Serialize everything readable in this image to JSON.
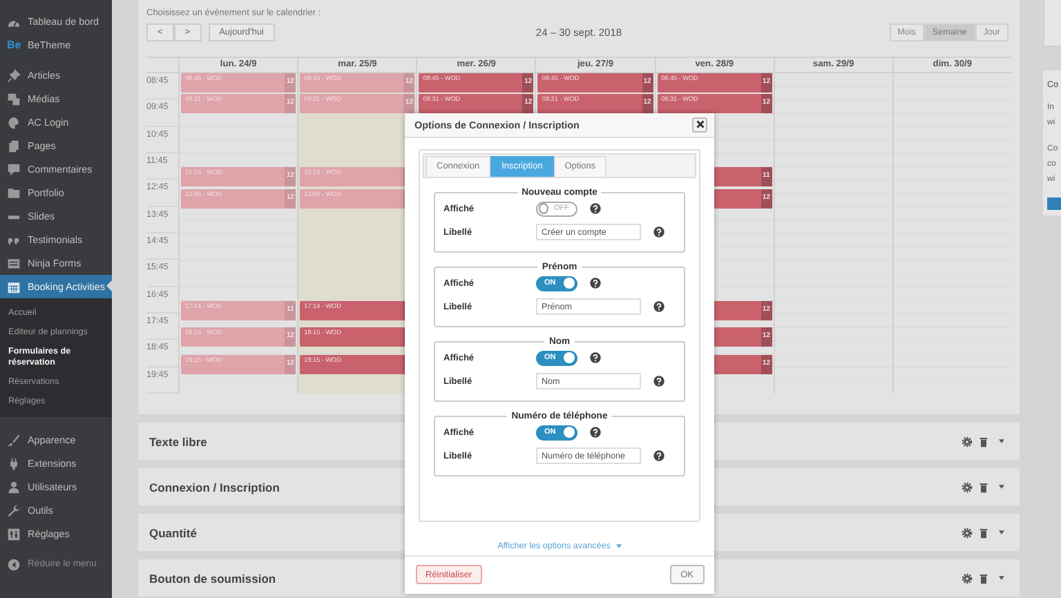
{
  "sidebar": {
    "groups": [
      [
        {
          "label": "Tableau de bord",
          "selected": false
        },
        {
          "label": "BeTheme",
          "logo": "Be",
          "selected": false
        }
      ],
      [
        {
          "label": "Articles",
          "selected": false
        },
        {
          "label": "Médias",
          "selected": false
        },
        {
          "label": "AC Login",
          "selected": false
        },
        {
          "label": "Pages",
          "selected": false
        },
        {
          "label": "Commentaires",
          "selected": false
        },
        {
          "label": "Portfolio",
          "selected": false
        },
        {
          "label": "Slides",
          "selected": false
        },
        {
          "label": "Testimonials",
          "selected": false
        },
        {
          "label": "Ninja Forms",
          "selected": false
        },
        {
          "label": "Booking Activities",
          "selected": true,
          "children": [
            {
              "label": "Accueil",
              "selected": false
            },
            {
              "label": "Editeur de plannings",
              "selected": false
            },
            {
              "label": "Formulaires de réservation",
              "selected": true
            },
            {
              "label": "Réservations",
              "selected": false
            },
            {
              "label": "Réglages",
              "selected": false
            }
          ]
        }
      ],
      [
        {
          "label": "Apparence",
          "selected": false
        },
        {
          "label": "Extensions",
          "selected": false
        },
        {
          "label": "Utilisateurs",
          "selected": false
        },
        {
          "label": "Outils",
          "selected": false
        },
        {
          "label": "Réglages",
          "selected": false
        }
      ]
    ],
    "collapse_button": {
      "label": "Réduire le menu"
    }
  },
  "calendar": {
    "prompt": "Choisissez un événement sur le calendrier :",
    "nav": [
      {
        "label": "<"
      },
      {
        "label": ">"
      }
    ],
    "today_button": "Aujourd'hui",
    "range_title": "24 – 30 sept. 2018",
    "views": [
      {
        "label": "Mois",
        "selected": false
      },
      {
        "label": "Semaine",
        "selected": true
      },
      {
        "label": "Jour",
        "selected": false
      }
    ],
    "days": [
      {
        "label": "lun. 24/9",
        "today": false
      },
      {
        "label": "mar. 25/9",
        "today": true
      },
      {
        "label": "mer. 26/9",
        "today": false
      },
      {
        "label": "jeu. 27/9",
        "today": false
      },
      {
        "label": "ven. 28/9",
        "today": false
      },
      {
        "label": "sam. 29/9",
        "today": false
      },
      {
        "label": "dim. 30/9",
        "today": false
      }
    ],
    "hours": [
      "08:45",
      "09:45",
      "10:45",
      "11:45",
      "12:45",
      "13:45",
      "14:45",
      "15:45",
      "16:45",
      "17:45",
      "18:45",
      "19:45"
    ],
    "slots": [
      {
        "events": [
          {
            "kind": "event",
            "label": "08:45 - WOD",
            "count": "12",
            "past": true
          },
          {
            "kind": "event",
            "label": "08:45 - WOD",
            "count": "12",
            "past": true
          },
          {
            "kind": "event",
            "label": "08:45 - WOD",
            "count": "12",
            "past": false
          },
          {
            "kind": "event",
            "label": "08:45 - WOD",
            "count": "12",
            "past": false
          },
          {
            "kind": "event",
            "label": "08:45 - WOD",
            "count": "12",
            "past": false
          },
          {
            "kind": "free"
          },
          {
            "kind": "free"
          }
        ]
      },
      {
        "events": [
          {
            "kind": "event",
            "label": "09:31 - WOD",
            "count": "12",
            "past": true
          },
          {
            "kind": "event",
            "label": "09:31 - WOD",
            "count": "12",
            "past": true
          },
          {
            "kind": "event",
            "label": "09:31 - WOD",
            "count": "12",
            "past": false
          },
          {
            "kind": "event",
            "label": "09:31 - WOD",
            "count": "12",
            "past": false
          },
          {
            "kind": "event",
            "label": "09:31 - WOD",
            "count": "12",
            "past": false
          },
          {
            "kind": "free"
          },
          {
            "kind": "free"
          }
        ]
      },
      {
        "events": [
          {
            "kind": "event",
            "label": "12:15 - WOD",
            "count": "12",
            "past": true
          },
          {
            "kind": "event",
            "label": "12:15 - WOD",
            "past": true
          },
          {
            "kind": "free"
          },
          {
            "kind": "free"
          },
          {
            "kind": "event",
            "count": "11",
            "past": false
          },
          {
            "kind": "free"
          },
          {
            "kind": "free"
          }
        ]
      },
      {
        "events": [
          {
            "kind": "event",
            "label": "13:05 - WOD",
            "count": "12",
            "past": true
          },
          {
            "kind": "event",
            "label": "13:05 - WOD",
            "past": true
          },
          {
            "kind": "free"
          },
          {
            "kind": "free"
          },
          {
            "kind": "event",
            "count": "12",
            "past": false
          },
          {
            "kind": "free"
          },
          {
            "kind": "free"
          }
        ]
      },
      {
        "events": [
          {
            "kind": "event",
            "label": "17:14 - WOD",
            "count": "11",
            "past": true
          },
          {
            "kind": "event",
            "label": "17:14 - WOD",
            "past": false
          },
          {
            "kind": "free"
          },
          {
            "kind": "free"
          },
          {
            "kind": "event",
            "count": "12",
            "past": false
          },
          {
            "kind": "free"
          },
          {
            "kind": "free"
          }
        ]
      },
      {
        "events": [
          {
            "kind": "event",
            "label": "18:15 - WOD",
            "count": "12",
            "past": true
          },
          {
            "kind": "event",
            "label": "18:15 - WOD",
            "past": false
          },
          {
            "kind": "free"
          },
          {
            "kind": "free"
          },
          {
            "kind": "event",
            "count": "12",
            "past": false
          },
          {
            "kind": "free"
          },
          {
            "kind": "free"
          }
        ]
      },
      {
        "events": [
          {
            "kind": "event",
            "label": "19:15 - WOD",
            "count": "12",
            "past": true
          },
          {
            "kind": "event",
            "label": "19:15 - WOD",
            "past": false
          },
          {
            "kind": "free"
          },
          {
            "kind": "free"
          },
          {
            "kind": "event",
            "count": "12",
            "past": false
          },
          {
            "kind": "free"
          },
          {
            "kind": "free"
          }
        ]
      }
    ]
  },
  "panels": [
    {
      "title": "Texte libre"
    },
    {
      "title": "Connexion / Inscription"
    },
    {
      "title": "Quantité"
    },
    {
      "title": "Bouton de soumission"
    }
  ],
  "side_panel": {
    "title": "Co",
    "paragraphs": [
      [
        "In",
        "wi"
      ],
      [
        "Co",
        "co",
        "wi"
      ]
    ]
  },
  "dialog": {
    "title": "Options de Connexion / Inscription",
    "tabs": [
      {
        "label": "Connexion",
        "selected": false
      },
      {
        "label": "Inscription",
        "selected": true
      },
      {
        "label": "Options",
        "selected": false
      }
    ],
    "sections": [
      {
        "legend": "Nouveau compte",
        "shown_label": "Affiché",
        "on": false,
        "toggle_text": "OFF",
        "field_label": "Libellé",
        "value": "Créer un compte"
      },
      {
        "legend": "Prénom",
        "shown_label": "Affiché",
        "on": true,
        "toggle_text": "ON",
        "field_label": "Libellé",
        "value": "Prénom"
      },
      {
        "legend": "Nom",
        "shown_label": "Affiché",
        "on": true,
        "toggle_text": "ON",
        "field_label": "Libellé",
        "value": "Nom"
      },
      {
        "legend": "Numéro de téléphone",
        "shown_label": "Affiché",
        "on": true,
        "toggle_text": "ON",
        "field_label": "Libellé",
        "value": "Numéro de téléphone"
      }
    ],
    "advanced_link": "Afficher les options avancées",
    "reset_button": "Réinitialiser",
    "ok_button": "OK"
  }
}
